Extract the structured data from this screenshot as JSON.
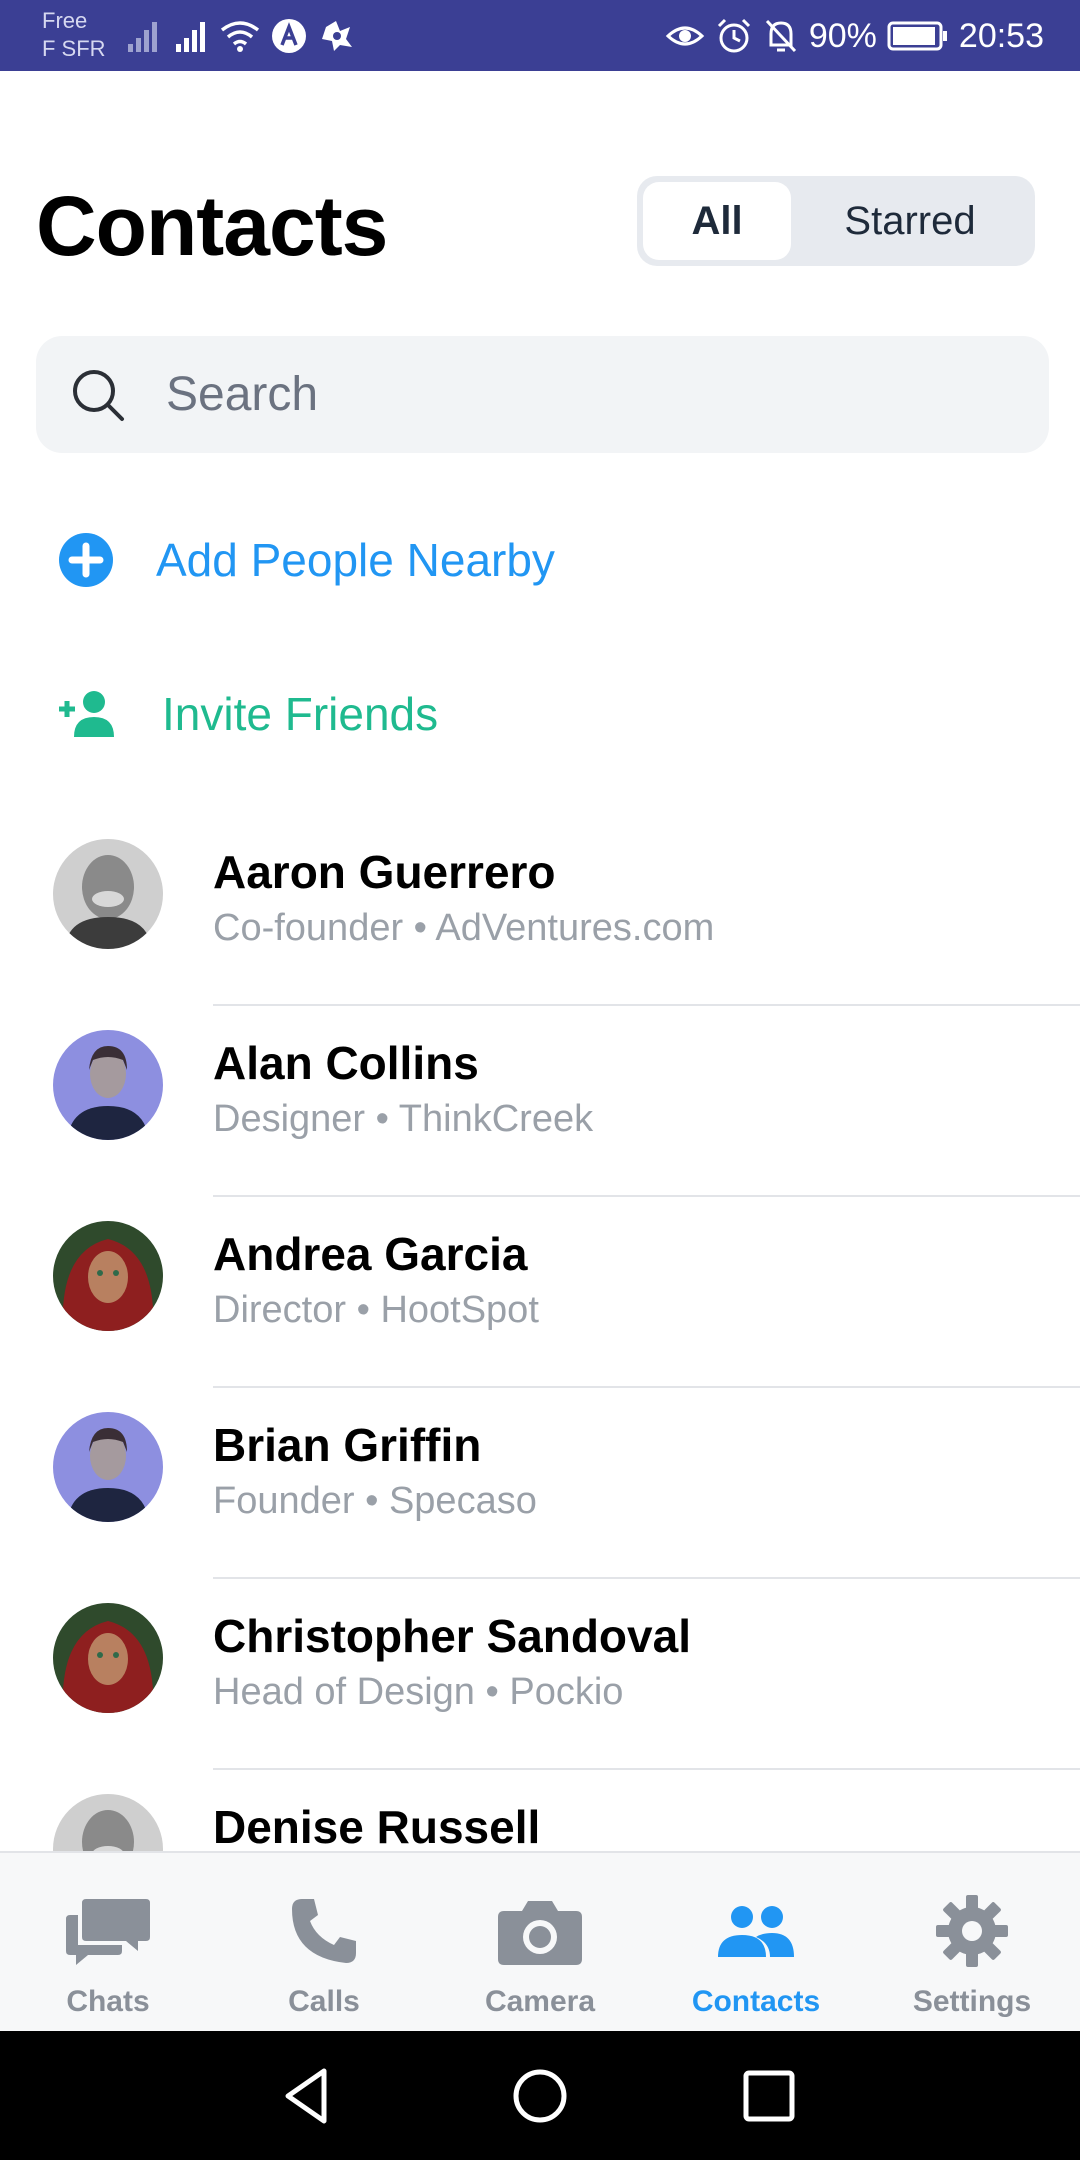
{
  "status_bar": {
    "carrier_line1": "Free",
    "carrier_line2": "F SFR",
    "battery": "90%",
    "time": "20:53"
  },
  "header": {
    "title": "Contacts",
    "segments": [
      "All",
      "Starred"
    ],
    "selected_segment": "All"
  },
  "search": {
    "placeholder": "Search"
  },
  "actions": {
    "add_nearby": "Add People Nearby",
    "invite": "Invite Friends"
  },
  "contacts": [
    {
      "name": "Aaron Guerrero",
      "subtitle": "Co-founder • AdVentures.com"
    },
    {
      "name": "Alan Collins",
      "subtitle": "Designer • ThinkCreek"
    },
    {
      "name": "Andrea Garcia",
      "subtitle": "Director • HootSpot"
    },
    {
      "name": "Brian Griffin",
      "subtitle": "Founder • Specaso"
    },
    {
      "name": "Christopher Sandoval",
      "subtitle": "Head of Design • Pockio"
    },
    {
      "name": "Denise Russell",
      "subtitle": ""
    }
  ],
  "tabs": [
    {
      "label": "Chats",
      "icon": "chat-bubbles-icon"
    },
    {
      "label": "Calls",
      "icon": "phone-icon"
    },
    {
      "label": "Camera",
      "icon": "camera-icon"
    },
    {
      "label": "Contacts",
      "icon": "contacts-icon"
    },
    {
      "label": "Settings",
      "icon": "gear-icon"
    }
  ],
  "active_tab": "Contacts",
  "colors": {
    "status_bar": "#3b3f94",
    "accent_blue": "#2196f3",
    "accent_green": "#1fba8f",
    "muted_text": "#9aa0a8",
    "tab_inactive": "#8a9099"
  }
}
